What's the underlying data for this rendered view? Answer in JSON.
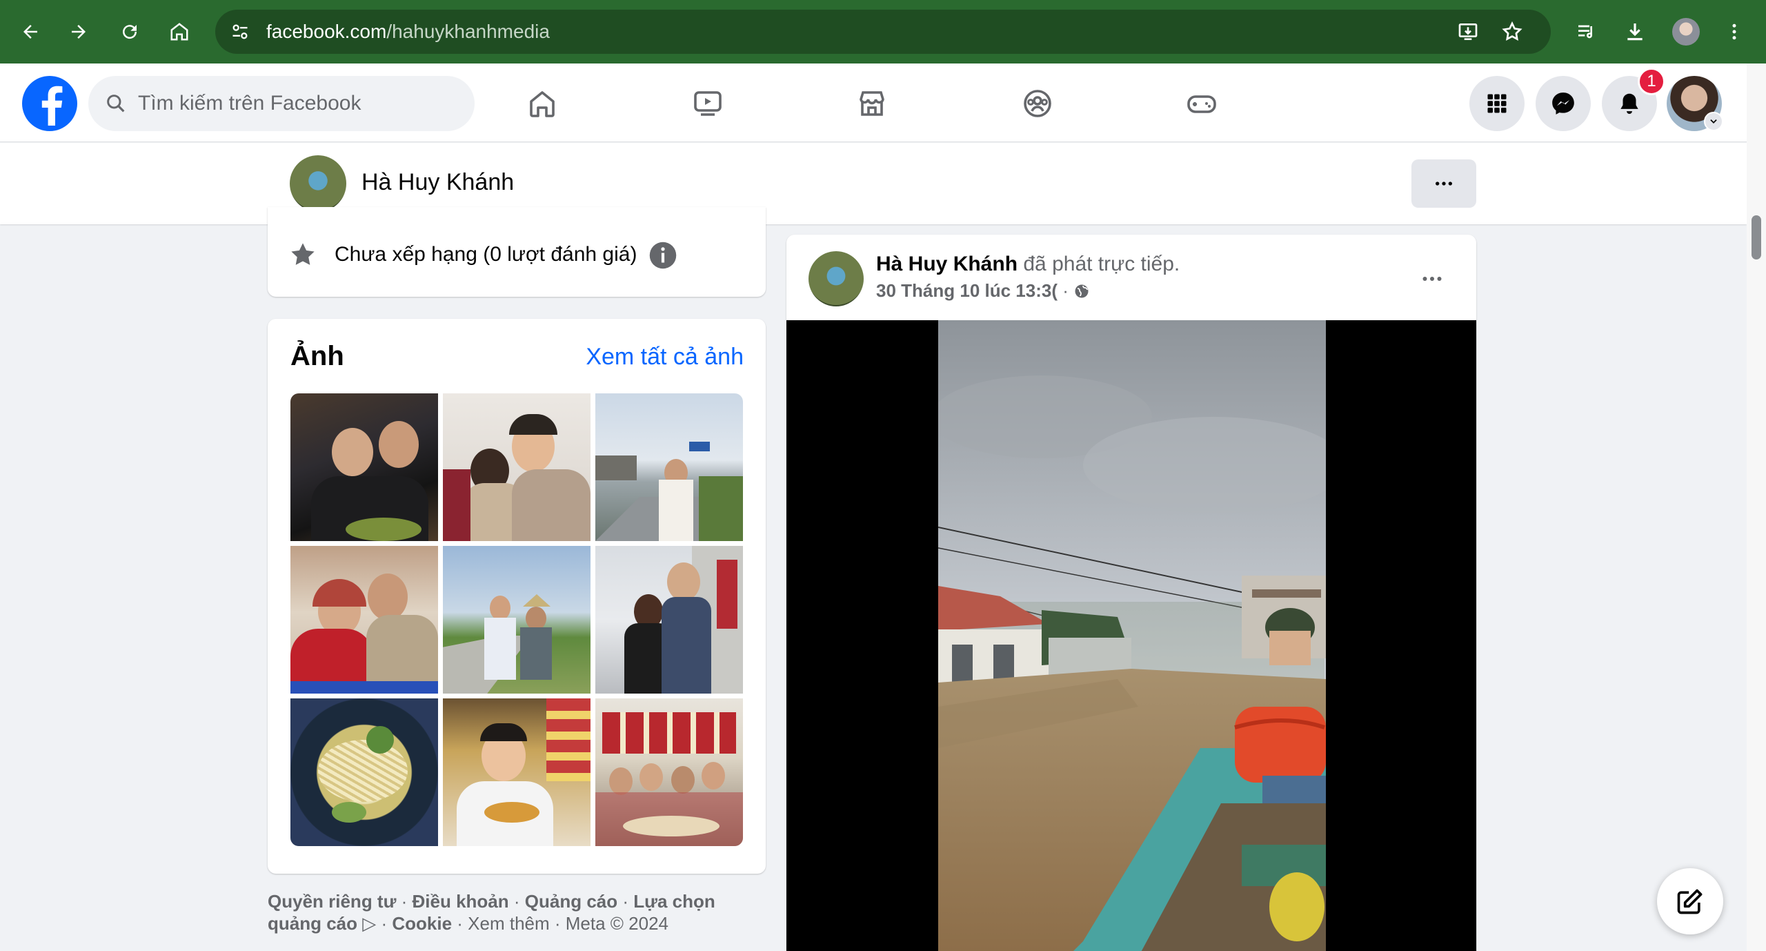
{
  "browser": {
    "url_domain": "facebook.com",
    "url_path": "/hahuykhanhmedia",
    "theme_color": "#2a6a2f"
  },
  "nav": {
    "search_placeholder": "Tìm kiếm trên Facebook",
    "notifications_count": "1",
    "brand_color": "#0866ff"
  },
  "profile": {
    "name": "Hà Huy Khánh"
  },
  "rating": {
    "text": "Chưa xếp hạng (0 lượt đánh giá)"
  },
  "photos": {
    "title": "Ảnh",
    "see_all": "Xem tất cả ảnh",
    "count_shown": 9
  },
  "footer": {
    "privacy": "Quyền riêng tư",
    "terms": "Điều khoản",
    "ads": "Quảng cáo",
    "ad_choices": "Lựa chọn quảng cáo",
    "cookie": "Cookie",
    "see_more": "Xem thêm",
    "meta": "Meta © 2024",
    "sep": " · "
  },
  "post": {
    "author": "Hà Huy Khánh",
    "action": "đã phát trực tiếp.",
    "timestamp": "30 Tháng 10 lúc 13:3(",
    "audience_icon": "globe-icon"
  }
}
